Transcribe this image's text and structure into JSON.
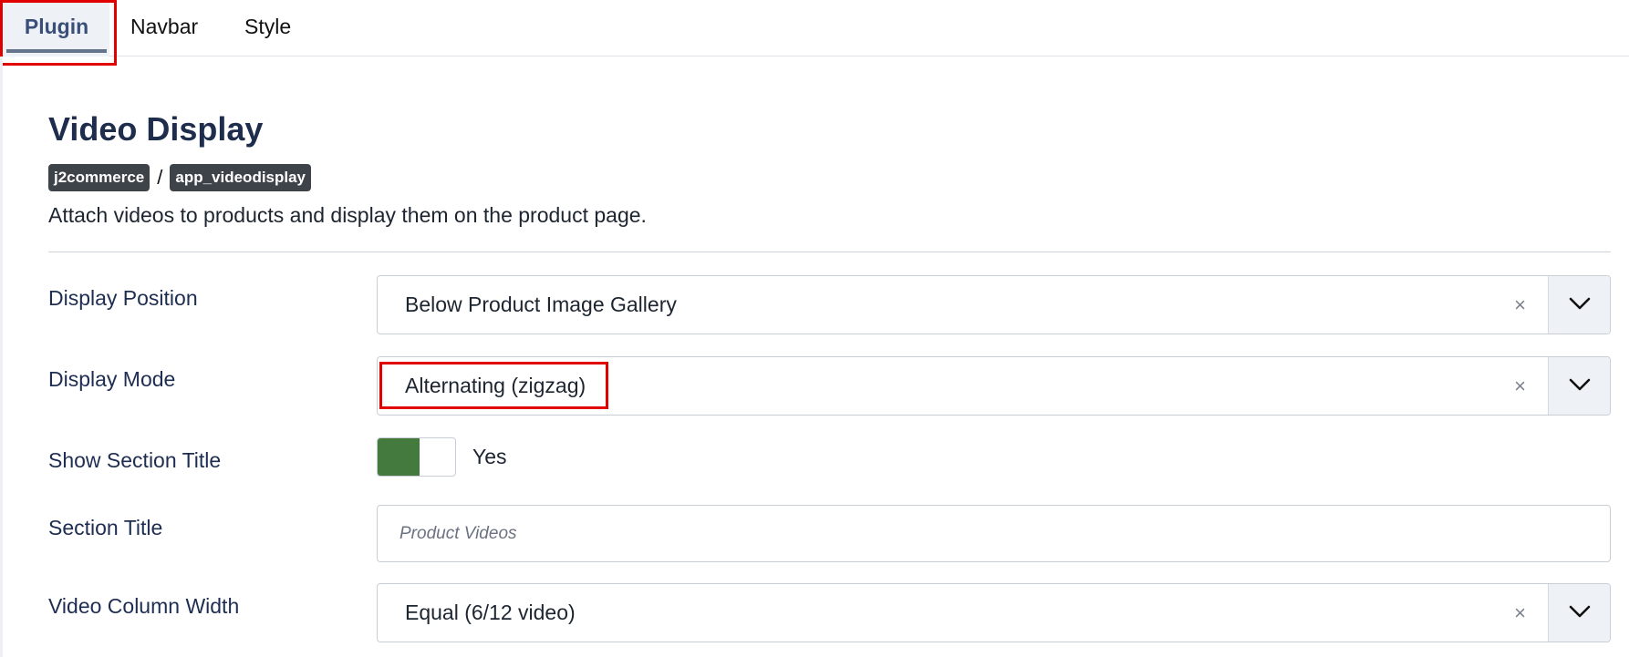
{
  "tabs": [
    {
      "label": "Plugin",
      "active": true
    },
    {
      "label": "Navbar",
      "active": false
    },
    {
      "label": "Style",
      "active": false
    }
  ],
  "header": {
    "title": "Video Display",
    "badges": [
      "j2commerce",
      "app_videodisplay"
    ],
    "separator": "/",
    "description": "Attach videos to products and display them on the product page."
  },
  "fields": {
    "display_position": {
      "label": "Display Position",
      "value": "Below Product Image Gallery"
    },
    "display_mode": {
      "label": "Display Mode",
      "value": "Alternating (zigzag)"
    },
    "show_section_title": {
      "label": "Show Section Title",
      "value": "Yes",
      "on": true
    },
    "section_title": {
      "label": "Section Title",
      "value": "",
      "placeholder": "Product Videos"
    },
    "video_column_width": {
      "label": "Video Column Width",
      "value": "Equal (6/12 video)"
    }
  },
  "icons": {
    "clear": "×",
    "dropdown": "chevron-down-icon"
  },
  "colors": {
    "toggle_on": "#457a3f",
    "highlight": "#e00000",
    "badge_bg": "#3d4349",
    "tab_active": "#3a4f78"
  }
}
